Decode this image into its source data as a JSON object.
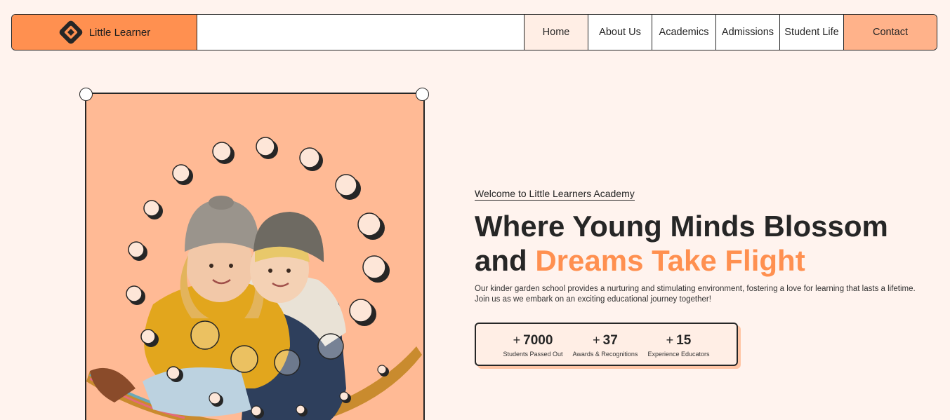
{
  "brand": {
    "name": "Little Learner",
    "logo_icon": "diamond-logo-icon"
  },
  "nav": {
    "items": [
      {
        "label": "Home",
        "active": true
      },
      {
        "label": "About Us"
      },
      {
        "label": "Academics"
      },
      {
        "label": "Admissions"
      },
      {
        "label": "Student Life"
      }
    ],
    "contact_label": "Contact"
  },
  "hero": {
    "welcome": "Welcome to Little Learners Academy",
    "headline_line1": "Where Young Minds Blossom",
    "headline_and": "and",
    "headline_accent": "Dreams Take Flight",
    "description": "Our kinder garden school provides a nurturing and stimulating environment, fostering a love for learning that lasts a lifetime. Join us as we embark on an exciting educational journey together!",
    "image_alt": "two-children-in-knit-hats"
  },
  "stats": [
    {
      "plus": "+",
      "value": "7000",
      "label": "Students Passed Out"
    },
    {
      "plus": "+",
      "value": "37",
      "label": "Awards & Recognitions"
    },
    {
      "plus": "+",
      "value": "15",
      "label": "Experience Educators"
    }
  ],
  "colors": {
    "accent": "#ff9050",
    "background": "#fff3ee",
    "image_bg": "#ffba95",
    "text": "#262626"
  }
}
